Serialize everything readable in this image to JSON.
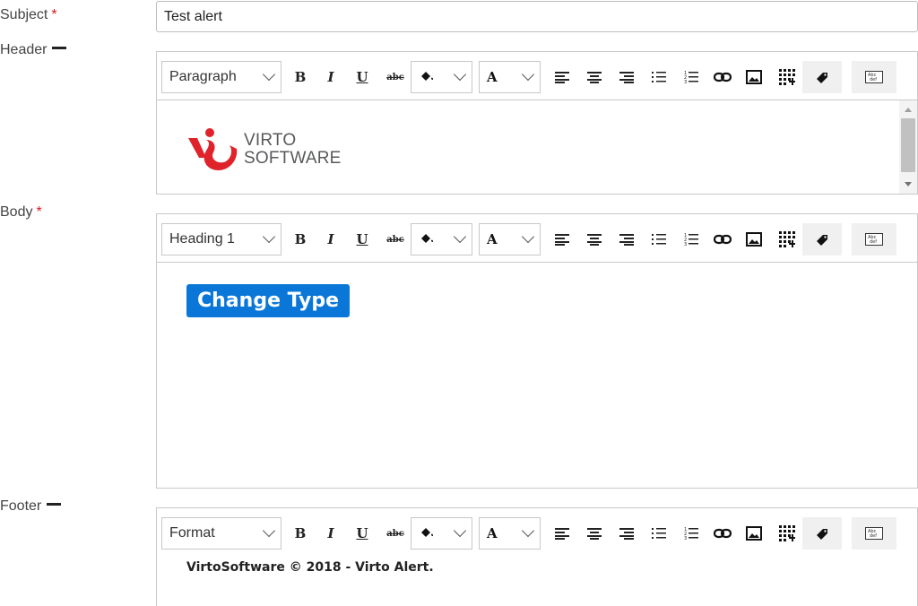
{
  "subject": {
    "label": "Subject",
    "required_mark": "*",
    "value": "Test alert"
  },
  "header": {
    "label": "Header",
    "format": "Paragraph",
    "logo_line1": "VIRTO",
    "logo_line2": "SOFTWARE"
  },
  "body": {
    "label": "Body",
    "required_mark": "*",
    "format": "Heading 1",
    "button_text": "Change Type"
  },
  "footer": {
    "label": "Footer",
    "format": "Format",
    "text": "VirtoSoftware © 2018 - Virto Alert."
  },
  "toolbar": {
    "bold": "B",
    "italic": "I",
    "underline": "U",
    "strikethrough": "abc",
    "font_color": "A",
    "icons": [
      "bold-icon",
      "italic-icon",
      "underline-icon",
      "strikethrough-icon",
      "fill-color-icon",
      "font-color-icon",
      "align-left-icon",
      "align-center-icon",
      "align-right-icon",
      "bullet-list-icon",
      "numbered-list-icon",
      "link-icon",
      "image-icon",
      "table-icon",
      "tag-icon",
      "spellcheck-icon"
    ]
  },
  "colors": {
    "accent_button": "#0a77d8",
    "required_mark": "#e0141e",
    "logo_red": "#e0232b"
  }
}
